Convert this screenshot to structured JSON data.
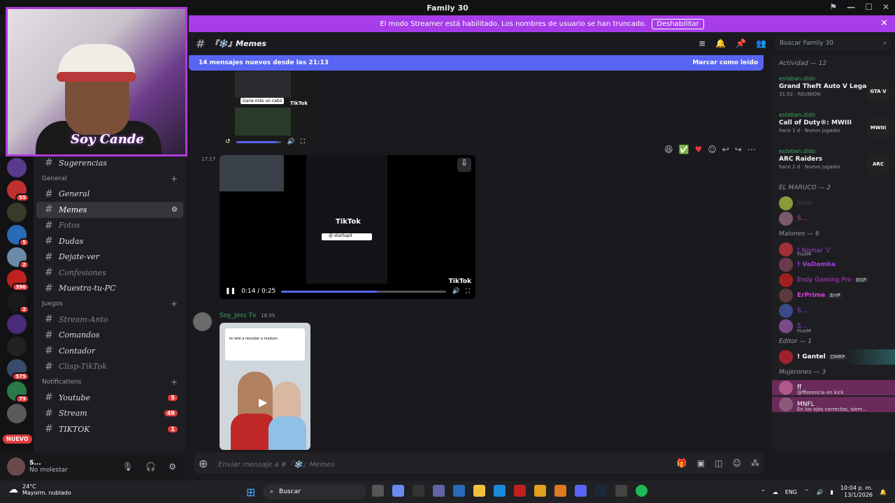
{
  "window_title": "Family 30",
  "streamer_banner": {
    "text": "El modo Streamer está habilitado. Los nombres de usuario se han truncado.",
    "button": "Deshabilitar"
  },
  "channel_header": {
    "name": "『❄️』Memes"
  },
  "search": {
    "placeholder": "Buscar Family 30"
  },
  "new_messages": {
    "text": "14 mensajes nuevos desde las 21:13",
    "mark_read": "Marcar como leído"
  },
  "webcam": {
    "overlay": "Soy Cande"
  },
  "categories": [
    {
      "label": "General",
      "channels": [
        {
          "name": "General"
        },
        {
          "name": "Memes"
        },
        {
          "name": "Fotos"
        },
        {
          "name": "Dudas"
        },
        {
          "name": "Dejate-ver"
        },
        {
          "name": "Confesiones"
        },
        {
          "name": "Muestra-tu-PC"
        }
      ]
    },
    {
      "label": "Juegos",
      "channels": [
        {
          "name": "Stream-Anto"
        },
        {
          "name": "Comandos"
        },
        {
          "name": "Contador"
        },
        {
          "name": "Clisp-TikTok"
        }
      ]
    },
    {
      "label": "Notifications",
      "channels": [
        {
          "name": "Youtube",
          "count": "5"
        },
        {
          "name": "Stream",
          "count": "49"
        },
        {
          "name": "TIKTOK",
          "count": "1"
        }
      ]
    }
  ],
  "top_channel": "Sugerencias",
  "server_badges": [
    "55",
    "5",
    "2",
    "396",
    "2",
    "575",
    "79"
  ],
  "nuevo": "NUEVO",
  "user": {
    "name": "S...",
    "status": "No molestar"
  },
  "messages": [
    {
      "time": "17:17",
      "video_time": "0:14 / 0:25",
      "progress": 0.58,
      "tiktok": "TikTok",
      "search_text": "@ startupd",
      "banner_text": "Gana más un cabo"
    },
    {
      "author": "Soy_Jess Tv",
      "time": "18:55",
      "image_caption": "te reto a rescatar a maduro"
    }
  ],
  "input": {
    "placeholder": "Enviar mensaje a #『❄️』Memes"
  },
  "activity": {
    "header": "Actividad — 12",
    "items": [
      {
        "user": "esteban.dido",
        "game": "Grand Theft Auto V Legacy",
        "meta": "31:52 · REUNION",
        "art": "GTA V"
      },
      {
        "user": "esteban.dido",
        "game": "Call of Duty®: MWIII",
        "meta": "hace 1 d · Nuevo jugador",
        "art": "MWIII"
      },
      {
        "user": "esteban.dido",
        "game": "ARC Raiders",
        "meta": "hace 2 d · Nuevo jugador",
        "art": "ARC"
      }
    ]
  },
  "member_groups": [
    {
      "label": "EL MARUCO — 2",
      "members": [
        {
          "name": "Jodel",
          "sub": ""
        },
        {
          "name": "S...",
          "sub": ""
        }
      ]
    },
    {
      "label": "Malones — 6",
      "members": [
        {
          "name": "! Nomar ツ",
          "sub": "FiveM"
        },
        {
          "name": "! VaDemka",
          "sub": ""
        },
        {
          "name": "Endy Gaming Pro",
          "sub": "EGP"
        },
        {
          "name": "ErPrime",
          "sub": "ErrP"
        },
        {
          "name": "S...",
          "sub": ""
        },
        {
          "name": "S...",
          "sub": "FiveM"
        }
      ]
    },
    {
      "label": "Editor — 1",
      "members": [
        {
          "name": "! Gantel",
          "sub": "DMRP"
        }
      ]
    },
    {
      "label": "Mujerones — 3",
      "members": [
        {
          "name": "ff",
          "sub": "@ffiorencia en kick"
        },
        {
          "name": "MNFL",
          "sub": "En los ojos correctos, siem..."
        }
      ]
    }
  ],
  "taskbar": {
    "temp": "24°C",
    "weather": "Mayorm. nublado",
    "search": "Buscar",
    "lang": "ENG",
    "time": "10:04 p. m.",
    "date": "13/1/2026"
  },
  "colors": {
    "banner": "#a73de8",
    "newbar": "#5865f2",
    "badge": "#e03c3c"
  }
}
